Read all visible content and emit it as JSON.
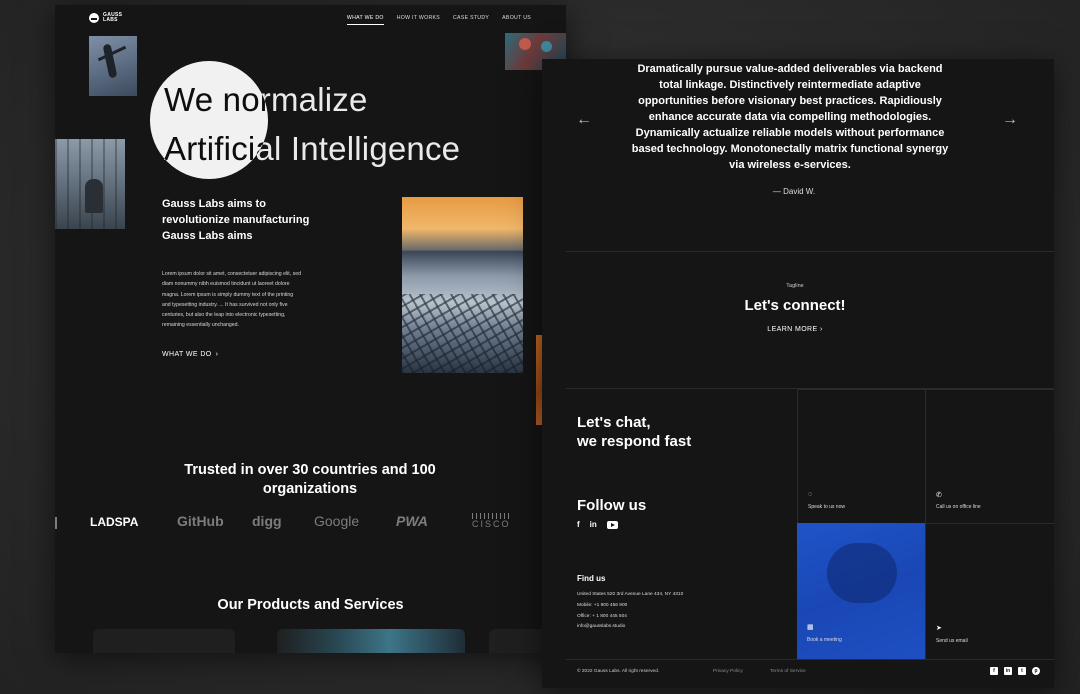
{
  "left": {
    "logo": "GAUSS LABS",
    "nav": [
      {
        "label": "WHAT WE DO",
        "active": true
      },
      {
        "label": "HOW IT WORKS",
        "active": false
      },
      {
        "label": "CASE STUDY",
        "active": false
      },
      {
        "label": "ABOUT US",
        "active": false
      }
    ],
    "hero_line1": "We normalize",
    "hero_line2": "Artificial Intelligence",
    "intro_title": "Gauss Labs aims to revolutionize manufacturing Gauss Labs aims",
    "intro_body": "Lorem ipsum dolor sit amet, consectetuer adipiscing elit, sed diam nonummy nibh euismod tincidunt ut laoreet dolore magna. Lorem ipsum is simply dummy text of the printing and typesetting industry. ... It has survived not only five centuries, but also the leap into electronic typesetting, remaining essentially unchanged.",
    "intro_link": "WHAT WE DO",
    "trusted": "Trusted in over 30 countries  and 100 organizations",
    "brands": [
      "LADSPA",
      "GitHub",
      "digg",
      "Google",
      "PWA",
      "CISCO"
    ],
    "products_title": "Our Products and Services"
  },
  "right": {
    "quote": "Dramatically pursue value-added deliverables via backend total linkage. Distinctively reintermediate adaptive opportunities before visionary best practices. Rapidiously enhance accurate data via compelling methodologies. Dynamically actualize reliable models without performance based technology. Monotonectally matrix functional synergy via wireless e-services.",
    "author": "— David W.",
    "arrow_prev": "←",
    "arrow_next": "→",
    "tagline": "Tagline",
    "connect_title": "Let's connect!",
    "learn_more": "LEARN MORE",
    "chat_line1": "Let's chat,",
    "chat_line2": "we respond fast",
    "follow_title": "Follow us",
    "find_title": "Find us",
    "address": "United States   520 3rd Avenue Lane  434, NY 4310",
    "mobile": "Mobile: +1 900 456 900",
    "office": "Office: + 1 800 445 504",
    "email": "info@gausslabs.studio",
    "speak_label": "Speak to us now",
    "call_label": "Call us on office line",
    "book_label": "Book a meeting",
    "email_label": "Send us email",
    "copyright": "© 2022 Gauss Labs. All right reserved.",
    "privacy": "Privacy Policy",
    "terms": "Terms of Service",
    "accent": "#1f54c9"
  }
}
